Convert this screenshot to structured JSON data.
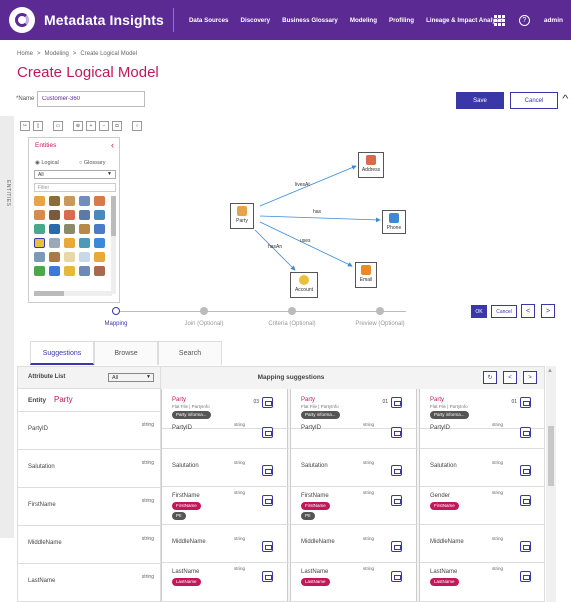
{
  "app": {
    "title": "Metadata Insights",
    "user": "admin"
  },
  "nav": [
    "Data Sources",
    "Discovery",
    "Business Glossary",
    "Modeling",
    "Profiling",
    "Lineage & Impact Analysis"
  ],
  "breadcrumb": [
    "Home",
    "Modeling",
    "Create Logical Model"
  ],
  "page_title": "Create Logical Model",
  "name_field": {
    "label": "*Name",
    "value": "Customer-360"
  },
  "buttons": {
    "save": "Save",
    "cancel": "Cancel",
    "ok": "OK",
    "cancel_small": "Cancel",
    "prev": "<",
    "next": ">"
  },
  "side_tab": "ENTITIES",
  "palette": {
    "title": "Entities",
    "radio_logical": "Logical",
    "radio_glossary": "Glossary",
    "select_value": "All",
    "filter_placeholder": "Filter"
  },
  "diagram": {
    "nodes": [
      "Party",
      "Address",
      "Phone",
      "Email",
      "Account"
    ],
    "edges": [
      "livesAt",
      "has",
      "uses",
      "hasAn"
    ]
  },
  "stepper": [
    "Mapping",
    "Join (Optional)",
    "Criteria (Optional)",
    "Preview (Optional)"
  ],
  "tabs": [
    "Suggestions",
    "Browse",
    "Search"
  ],
  "mapping": {
    "attr_list_label": "Attribute List",
    "attr_list_value": "All",
    "entity_label": "Entity",
    "entity_name": "Party",
    "header": "Mapping suggestions",
    "attributes": [
      {
        "name": "PartyID",
        "type": "string"
      },
      {
        "name": "Salutation",
        "type": "string"
      },
      {
        "name": "FirstName",
        "type": "string"
      },
      {
        "name": "MiddleName",
        "type": "string"
      },
      {
        "name": "LastName",
        "type": "string"
      }
    ],
    "suggestions": [
      {
        "entity": "Party",
        "source": "Flat File | PartyInfo",
        "pill": "Party informa...",
        "score": "03",
        "cells": [
          {
            "name": "PartyID",
            "type": "string",
            "tags": []
          },
          {
            "name": "Salutation",
            "type": "string",
            "tags": []
          },
          {
            "name": "FirstName",
            "type": "string",
            "tags": [
              {
                "text": "FirstName",
                "style": "pink"
              },
              {
                "text": "PII",
                "style": "dark"
              }
            ]
          },
          {
            "name": "MiddleName",
            "type": "string",
            "tags": []
          },
          {
            "name": "LastName",
            "type": "string",
            "tags": [
              {
                "text": "LastName",
                "style": "pink"
              }
            ]
          }
        ]
      },
      {
        "entity": "Party",
        "source": "Flat File | PartyInfo",
        "pill": "Party informa...",
        "score": "01",
        "cells": [
          {
            "name": "PartyID",
            "type": "string",
            "tags": []
          },
          {
            "name": "Salutation",
            "type": "string",
            "tags": []
          },
          {
            "name": "FirstName",
            "type": "string",
            "tags": [
              {
                "text": "FirstName",
                "style": "pink"
              },
              {
                "text": "PII",
                "style": "dark"
              }
            ]
          },
          {
            "name": "MiddleName",
            "type": "string",
            "tags": []
          },
          {
            "name": "LastName",
            "type": "string",
            "tags": [
              {
                "text": "LastName",
                "style": "pink"
              }
            ]
          }
        ]
      },
      {
        "entity": "Party",
        "source": "Flat File | PartyInfo",
        "pill": "Party informa...",
        "score": "01",
        "cells": [
          {
            "name": "PartyID",
            "type": "string",
            "tags": []
          },
          {
            "name": "Salutation",
            "type": "string",
            "tags": []
          },
          {
            "name": "Gender",
            "type": "string",
            "tags": [
              {
                "text": "FirstName",
                "style": "pink"
              }
            ]
          },
          {
            "name": "MiddleName",
            "type": "string",
            "tags": []
          },
          {
            "name": "LastName",
            "type": "string",
            "tags": [
              {
                "text": "LastName",
                "style": "pink"
              }
            ]
          }
        ]
      }
    ]
  },
  "colors": {
    "brand": "#5b2a92",
    "accent": "#3a38a8",
    "pink": "#c2185b"
  }
}
